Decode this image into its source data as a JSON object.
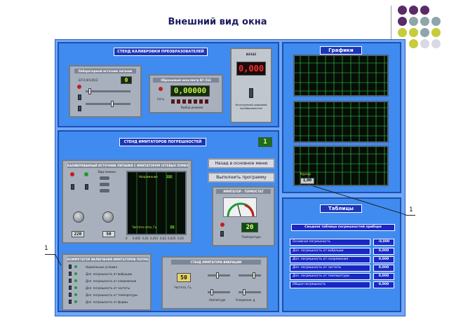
{
  "slide_title": "Внешний вид окна",
  "callouts": {
    "left": "1",
    "right": "1"
  },
  "calibration": {
    "title": "СТЕНД КАЛИБРОВКИ ПРЕОБРАЗОВАТЕЛЕЙ",
    "voltage_source_title": "Лабораторный источник питания",
    "source_display": "0",
    "source_model": "БП 0,9/1/45/2",
    "voltmeter_title": "Образцовый вольтметр В7-516",
    "voltmeter_display": "0,00000",
    "voltmeter_caption": "Выбор режима",
    "small_label": "Сеть",
    "adc_title": "АЭ142",
    "adc_display": "0,000",
    "adc_caption": "Исследуемый цифровой преобразователь"
  },
  "graphs": {
    "title": "Графики",
    "cursor_label": "Курсор",
    "cursor_value": "1,00"
  },
  "simulators": {
    "title": "СТЕНД ИМИТАТОРОВ ПОГРЕШНОСТЕЙ",
    "number": "1",
    "sine_title": "КАЛИБРОВАННЫЙ ИСТОЧНИК ПИТАНИЯ С ИМИТАТОРОМ СЕТЕВЫХ ПОМЕХ",
    "plot_label_top": "Напряжение",
    "plot_value_top": "220",
    "plot_label_bottom": "Частота сети, Гц",
    "plot_value_bottom": "50",
    "plot_ticks": [
      "0",
      "0,005",
      "0,01",
      "0,015",
      "0,02",
      "0,025",
      "0,03"
    ],
    "knob_value_left": "220",
    "knob_value_right": "50",
    "noise_label": "Вид помехи",
    "button_main_menu": "Назад в основное меню",
    "button_run": "Выполнить программу",
    "thermostat_title": "ИМИТАТОР - ТЕРМОСТАТ",
    "temperature_value": "20",
    "temperature_label": "Температура",
    "switch_title": "КОММУТАТОР ВКЛЮЧЕНИЯ ИМИТАТОРОВ ПОГРЕШНОСТИ",
    "switch_items": [
      "Нормальные условия",
      "Доп. погрешность от вибрации",
      "Доп. погрешность от напряжения",
      "Доп. погрешность от частоты",
      "Доп. погрешность от температуры",
      "Доп. погрешность от формы"
    ],
    "vibration_title": "СТЕНД ИМИТАТОРА ВИБРАЦИИ",
    "vibration_value": "50",
    "vibration_label": "Частота, Гц",
    "amplitude_label": "Амплитуда",
    "acceleration_label": "Ускорение, g"
  },
  "tables": {
    "title": "Таблицы",
    "subtitle": "Сводная таблица погрешностей прибора",
    "rows": [
      {
        "label": "Основная погрешность",
        "value": "-0,000"
      },
      {
        "label": "Доп. погрешность от вибрации",
        "value": "0,000"
      },
      {
        "label": "Доп. погрешность от напряжения",
        "value": "0,000"
      },
      {
        "label": "Доп. погрешность от частоты",
        "value": "0,000"
      },
      {
        "label": "Доп. погрешность от температуры",
        "value": "0,000"
      },
      {
        "label": "Общая погрешность",
        "value": "0,000"
      }
    ]
  },
  "colors": {
    "panel_blue": "#3f8bf0",
    "header_navy": "#1b36b8",
    "lcd_green": "#c4f24a",
    "lcd_red": "#ff2d2d",
    "grid_green": "#2ee04a",
    "dot_purple": "#5b2a68",
    "dot_gray": "#8fa6a8",
    "dot_yellow": "#c6cc3a"
  },
  "icons": [
    "window-frame",
    "lcd-display",
    "oscilloscope-grid",
    "rotary-knob",
    "toggle-switch",
    "indicator-led",
    "needle-gauge"
  ]
}
